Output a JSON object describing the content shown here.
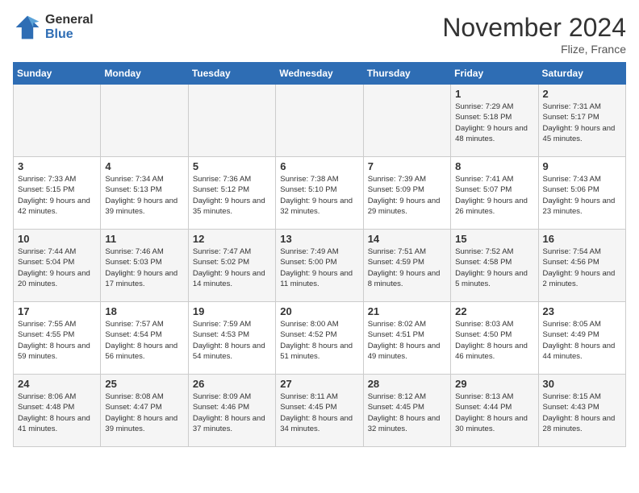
{
  "header": {
    "logo_line1": "General",
    "logo_line2": "Blue",
    "month": "November 2024",
    "location": "Flize, France"
  },
  "weekdays": [
    "Sunday",
    "Monday",
    "Tuesday",
    "Wednesday",
    "Thursday",
    "Friday",
    "Saturday"
  ],
  "weeks": [
    [
      {
        "day": "",
        "info": ""
      },
      {
        "day": "",
        "info": ""
      },
      {
        "day": "",
        "info": ""
      },
      {
        "day": "",
        "info": ""
      },
      {
        "day": "",
        "info": ""
      },
      {
        "day": "1",
        "info": "Sunrise: 7:29 AM\nSunset: 5:18 PM\nDaylight: 9 hours and 48 minutes."
      },
      {
        "day": "2",
        "info": "Sunrise: 7:31 AM\nSunset: 5:17 PM\nDaylight: 9 hours and 45 minutes."
      }
    ],
    [
      {
        "day": "3",
        "info": "Sunrise: 7:33 AM\nSunset: 5:15 PM\nDaylight: 9 hours and 42 minutes."
      },
      {
        "day": "4",
        "info": "Sunrise: 7:34 AM\nSunset: 5:13 PM\nDaylight: 9 hours and 39 minutes."
      },
      {
        "day": "5",
        "info": "Sunrise: 7:36 AM\nSunset: 5:12 PM\nDaylight: 9 hours and 35 minutes."
      },
      {
        "day": "6",
        "info": "Sunrise: 7:38 AM\nSunset: 5:10 PM\nDaylight: 9 hours and 32 minutes."
      },
      {
        "day": "7",
        "info": "Sunrise: 7:39 AM\nSunset: 5:09 PM\nDaylight: 9 hours and 29 minutes."
      },
      {
        "day": "8",
        "info": "Sunrise: 7:41 AM\nSunset: 5:07 PM\nDaylight: 9 hours and 26 minutes."
      },
      {
        "day": "9",
        "info": "Sunrise: 7:43 AM\nSunset: 5:06 PM\nDaylight: 9 hours and 23 minutes."
      }
    ],
    [
      {
        "day": "10",
        "info": "Sunrise: 7:44 AM\nSunset: 5:04 PM\nDaylight: 9 hours and 20 minutes."
      },
      {
        "day": "11",
        "info": "Sunrise: 7:46 AM\nSunset: 5:03 PM\nDaylight: 9 hours and 17 minutes."
      },
      {
        "day": "12",
        "info": "Sunrise: 7:47 AM\nSunset: 5:02 PM\nDaylight: 9 hours and 14 minutes."
      },
      {
        "day": "13",
        "info": "Sunrise: 7:49 AM\nSunset: 5:00 PM\nDaylight: 9 hours and 11 minutes."
      },
      {
        "day": "14",
        "info": "Sunrise: 7:51 AM\nSunset: 4:59 PM\nDaylight: 9 hours and 8 minutes."
      },
      {
        "day": "15",
        "info": "Sunrise: 7:52 AM\nSunset: 4:58 PM\nDaylight: 9 hours and 5 minutes."
      },
      {
        "day": "16",
        "info": "Sunrise: 7:54 AM\nSunset: 4:56 PM\nDaylight: 9 hours and 2 minutes."
      }
    ],
    [
      {
        "day": "17",
        "info": "Sunrise: 7:55 AM\nSunset: 4:55 PM\nDaylight: 8 hours and 59 minutes."
      },
      {
        "day": "18",
        "info": "Sunrise: 7:57 AM\nSunset: 4:54 PM\nDaylight: 8 hours and 56 minutes."
      },
      {
        "day": "19",
        "info": "Sunrise: 7:59 AM\nSunset: 4:53 PM\nDaylight: 8 hours and 54 minutes."
      },
      {
        "day": "20",
        "info": "Sunrise: 8:00 AM\nSunset: 4:52 PM\nDaylight: 8 hours and 51 minutes."
      },
      {
        "day": "21",
        "info": "Sunrise: 8:02 AM\nSunset: 4:51 PM\nDaylight: 8 hours and 49 minutes."
      },
      {
        "day": "22",
        "info": "Sunrise: 8:03 AM\nSunset: 4:50 PM\nDaylight: 8 hours and 46 minutes."
      },
      {
        "day": "23",
        "info": "Sunrise: 8:05 AM\nSunset: 4:49 PM\nDaylight: 8 hours and 44 minutes."
      }
    ],
    [
      {
        "day": "24",
        "info": "Sunrise: 8:06 AM\nSunset: 4:48 PM\nDaylight: 8 hours and 41 minutes."
      },
      {
        "day": "25",
        "info": "Sunrise: 8:08 AM\nSunset: 4:47 PM\nDaylight: 8 hours and 39 minutes."
      },
      {
        "day": "26",
        "info": "Sunrise: 8:09 AM\nSunset: 4:46 PM\nDaylight: 8 hours and 37 minutes."
      },
      {
        "day": "27",
        "info": "Sunrise: 8:11 AM\nSunset: 4:45 PM\nDaylight: 8 hours and 34 minutes."
      },
      {
        "day": "28",
        "info": "Sunrise: 8:12 AM\nSunset: 4:45 PM\nDaylight: 8 hours and 32 minutes."
      },
      {
        "day": "29",
        "info": "Sunrise: 8:13 AM\nSunset: 4:44 PM\nDaylight: 8 hours and 30 minutes."
      },
      {
        "day": "30",
        "info": "Sunrise: 8:15 AM\nSunset: 4:43 PM\nDaylight: 8 hours and 28 minutes."
      }
    ]
  ]
}
